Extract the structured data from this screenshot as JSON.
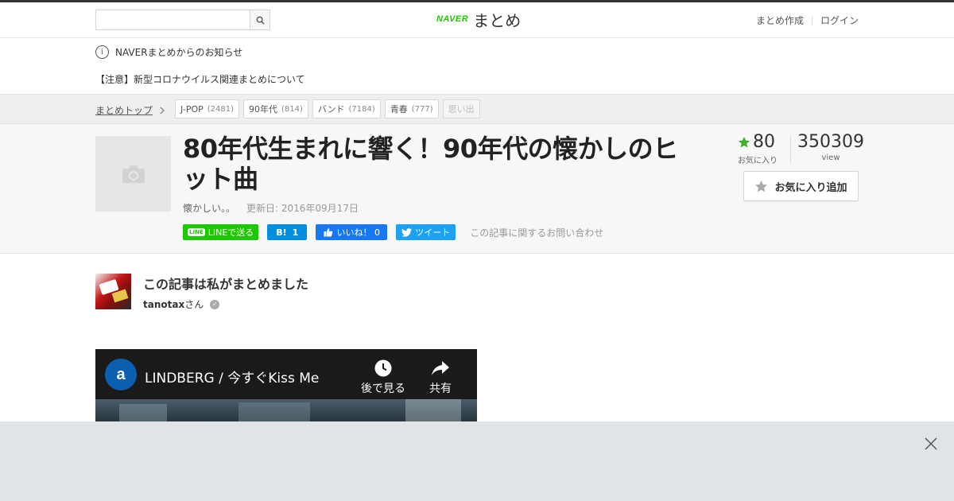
{
  "header": {
    "search_placeholder": "",
    "logo_brand": "NAVER",
    "logo_text": "まとめ",
    "links": [
      "まとめ作成",
      "ログイン"
    ]
  },
  "notice": {
    "heading": "NAVERまとめからのお知らせ",
    "item": "【注意】新型コロナウイルス関連まとめについて"
  },
  "breadcrumb": {
    "top": "まとめトップ",
    "tags": [
      {
        "label": "J-POP",
        "count": "(2481)"
      },
      {
        "label": "90年代",
        "count": "(814)"
      },
      {
        "label": "バンド",
        "count": "(7184)"
      },
      {
        "label": "青春",
        "count": "(777)"
      },
      {
        "label": "思い出",
        "count": ""
      }
    ]
  },
  "article": {
    "title": "80年代生まれに響く！90年代の懐かしのヒット曲",
    "description": "懐かしい。。",
    "updated": "更新日: 2016年09月17日",
    "favorites_count": "80",
    "favorites_label": "お気に入り",
    "views_count": "350309",
    "views_label": "view",
    "favorite_button": "お気に入り追加",
    "contact": "この記事に関するお問い合わせ"
  },
  "share": {
    "line": "LINEで送る",
    "hatena_count": "1",
    "facebook": "いいね！ 0",
    "twitter": "ツイート"
  },
  "author": {
    "heading": "この記事は私がまとめました",
    "name": "tanotax",
    "suffix": "さん"
  },
  "video": {
    "title": "LINDBERG / 今すぐKiss Me",
    "watch_later": "後で見る",
    "share": "共有"
  },
  "colors": {
    "naver_green": "#1ec800",
    "hatena_blue": "#008fde",
    "facebook_blue": "#1877f2",
    "twitter_blue": "#1da1f2",
    "favorite_star": "#3fae2a"
  }
}
